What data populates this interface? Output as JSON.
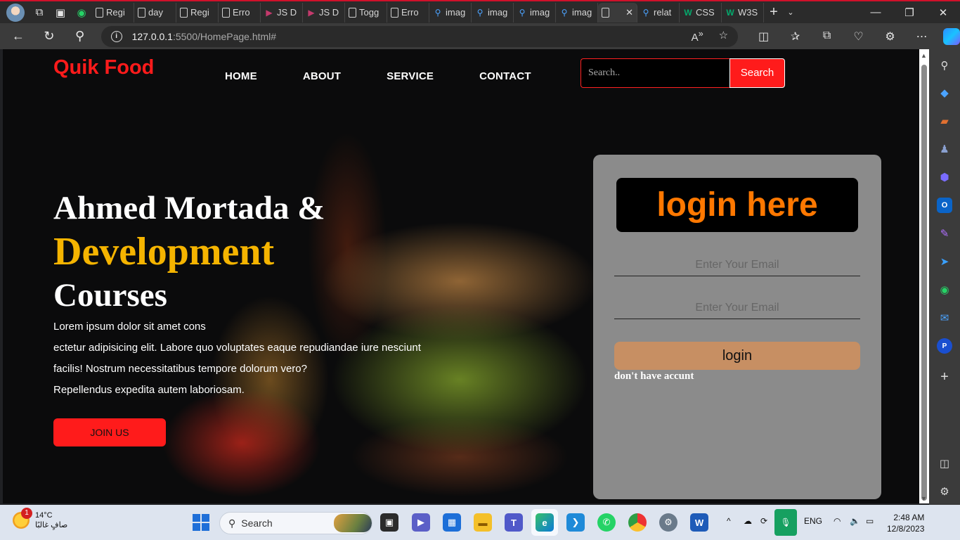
{
  "browser": {
    "tabs": [
      {
        "title": "Regi",
        "icon": "doc"
      },
      {
        "title": "day",
        "icon": "doc"
      },
      {
        "title": "Regi",
        "icon": "doc"
      },
      {
        "title": "Erro",
        "icon": "doc"
      },
      {
        "title": "JS D",
        "icon": "vs"
      },
      {
        "title": "JS D",
        "icon": "vs"
      },
      {
        "title": "Togg",
        "icon": "doc"
      },
      {
        "title": "Erro",
        "icon": "doc"
      },
      {
        "title": "imag",
        "icon": "search"
      },
      {
        "title": "imag",
        "icon": "search"
      },
      {
        "title": "imag",
        "icon": "search"
      },
      {
        "title": "imag",
        "icon": "search"
      },
      {
        "title": "",
        "icon": "doc",
        "active": true
      },
      {
        "title": "relat",
        "icon": "search"
      },
      {
        "title": "CSS",
        "icon": "w3"
      },
      {
        "title": "W3S",
        "icon": "w3"
      }
    ],
    "url_host": "127.0.0.1",
    "url_path": ":5500/HomePage.html#"
  },
  "site": {
    "logo": "Quik Food",
    "nav": [
      "HOME",
      "ABOUT",
      "SERVICE",
      "CONTACT"
    ],
    "search_placeholder": "Search..",
    "search_button": "Search",
    "hero": {
      "line1": "Ahmed Mortada &",
      "line2": "Development",
      "line3": "Courses",
      "para_lines": [
        "Lorem ipsum dolor sit amet cons",
        "ectetur adipisicing elit. Labore quo voluptates eaque repudiandae iure nesciunt",
        "facilis! Nostrum necessitatibus tempore dolorum vero?",
        "Repellendus expedita autem laboriosam."
      ],
      "cta": "JOIN US"
    },
    "login": {
      "title": "login here",
      "email_placeholder": "Enter Your Email",
      "password_placeholder": "Enter Your Email",
      "button": "login",
      "signup_text": "don't have accunt"
    },
    "colors": {
      "brand_red": "#ff1b1b",
      "accent_yellow": "#f5b400",
      "login_orange": "#ff7800",
      "login_button": "#c78f63"
    }
  },
  "taskbar": {
    "weather_temp": "14°C",
    "weather_desc": "صافٍ غالبًا",
    "weather_badge": "1",
    "search_label": "Search",
    "language": "ENG",
    "time": "2:48 AM",
    "date": "12/8/2023"
  }
}
